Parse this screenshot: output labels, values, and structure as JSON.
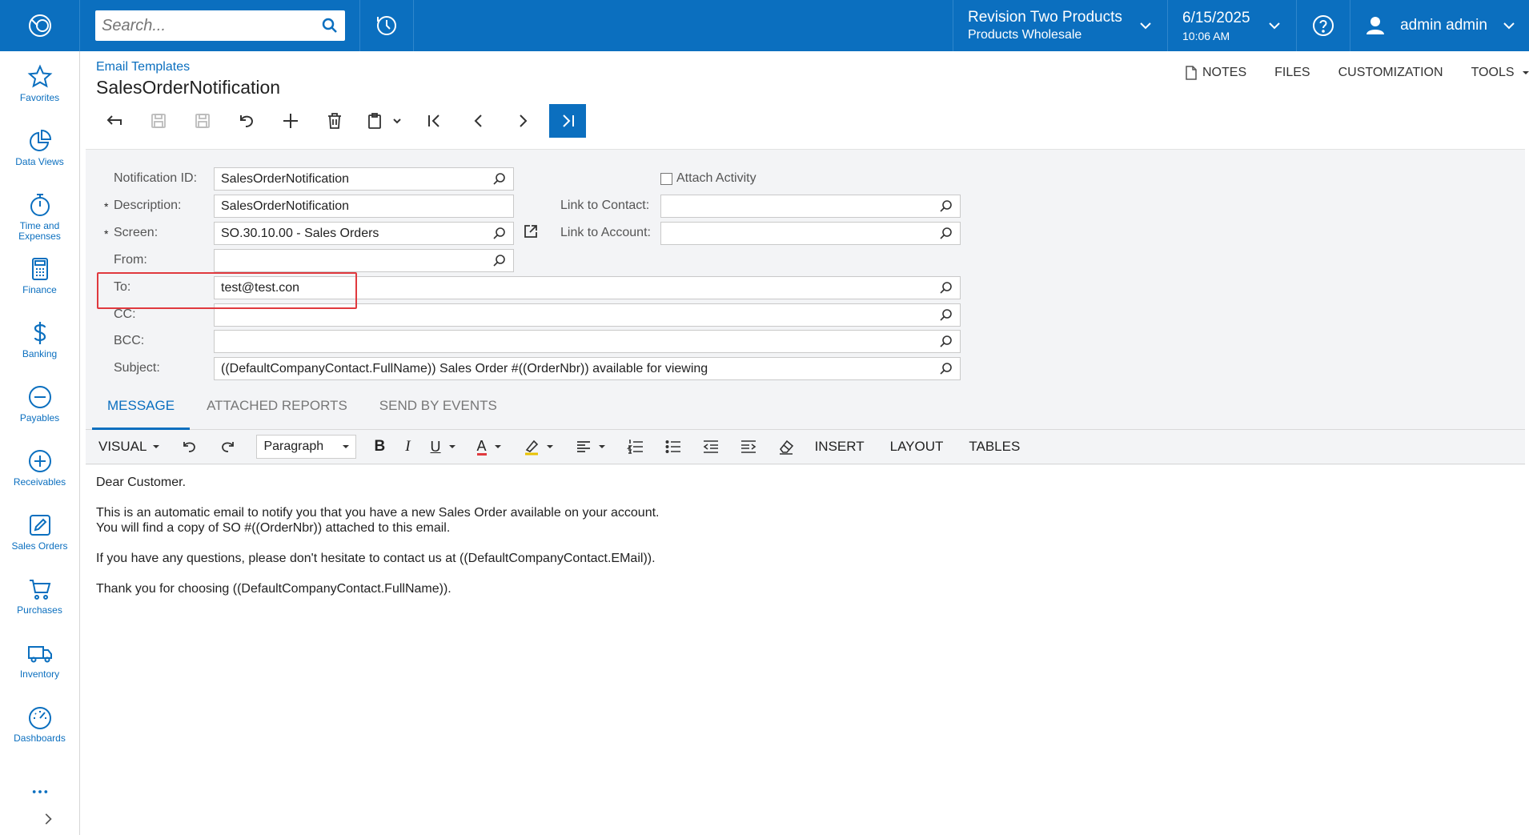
{
  "topbar": {
    "search_placeholder": "Search...",
    "company_name": "Revision Two Products",
    "company_branch": "Products Wholesale",
    "date": "6/15/2025",
    "time": "10:06 AM",
    "user": "admin admin"
  },
  "nav": [
    {
      "label": "Favorites",
      "icon": "star-icon"
    },
    {
      "label": "Data Views",
      "icon": "pie-chart-icon"
    },
    {
      "label": "Time and Expenses",
      "icon": "stopwatch-icon"
    },
    {
      "label": "Finance",
      "icon": "calculator-icon"
    },
    {
      "label": "Banking",
      "icon": "dollar-icon"
    },
    {
      "label": "Payables",
      "icon": "minus-circle-icon"
    },
    {
      "label": "Receivables",
      "icon": "plus-circle-icon"
    },
    {
      "label": "Sales Orders",
      "icon": "pencil-icon"
    },
    {
      "label": "Purchases",
      "icon": "cart-icon"
    },
    {
      "label": "Inventory",
      "icon": "truck-icon"
    },
    {
      "label": "Dashboards",
      "icon": "gauge-icon"
    }
  ],
  "header": {
    "breadcrumb": "Email Templates",
    "title": "SalesOrderNotification",
    "actions": {
      "notes": "NOTES",
      "files": "FILES",
      "customization": "CUSTOMIZATION",
      "tools": "TOOLS"
    }
  },
  "form": {
    "notification_id_label": "Notification ID:",
    "notification_id": "SalesOrderNotification",
    "description_label": "Description:",
    "description": "SalesOrderNotification",
    "screen_label": "Screen:",
    "screen": "SO.30.10.00 - Sales Orders",
    "from_label": "From:",
    "from": "",
    "to_label": "To:",
    "to": "test@test.con",
    "cc_label": "CC:",
    "cc": "",
    "bcc_label": "BCC:",
    "bcc": "",
    "subject_label": "Subject:",
    "subject": "((DefaultCompanyContact.FullName)) Sales Order #((OrderNbr)) available for viewing",
    "attach_activity_label": "Attach Activity",
    "link_contact_label": "Link to Contact:",
    "link_contact": "",
    "link_account_label": "Link to Account:",
    "link_account": "",
    "required_mark": "*"
  },
  "tabs": [
    "MESSAGE",
    "ATTACHED REPORTS",
    "SEND BY EVENTS"
  ],
  "editor_toolbar": {
    "mode": "VISUAL",
    "paragraph": "Paragraph",
    "bold": "B",
    "italic": "I",
    "underline": "U",
    "font_color": "A",
    "insert": "INSERT",
    "layout": "LAYOUT",
    "tables": "TABLES"
  },
  "message": {
    "greeting": "Dear Customer.",
    "line1": "This is an automatic email to notify you that you have a new Sales Order available on your account.",
    "line2": "You will find a copy of SO #((OrderNbr)) attached to this email.",
    "line3": "If you have any questions, please don't hesitate to contact us at ((DefaultCompanyContact.EMail)).",
    "line4": "Thank you for choosing ((DefaultCompanyContact.FullName))."
  },
  "colors": {
    "accent": "#0b6fbf",
    "highlight": "#e0393e"
  }
}
